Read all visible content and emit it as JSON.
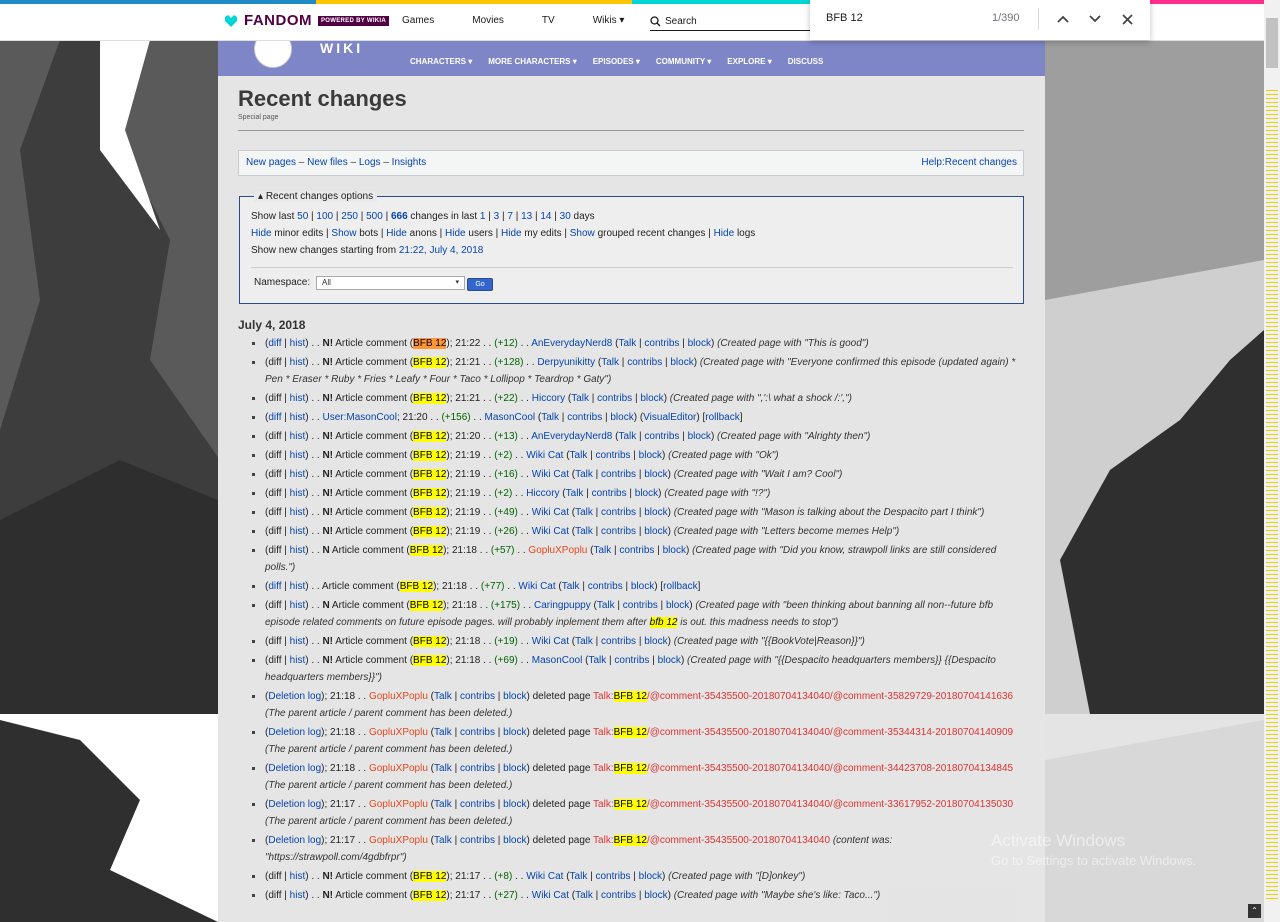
{
  "fandom": {
    "logo_text": "FANDOM",
    "powered_text": "POWERED BY WIKIA",
    "nav": [
      "Games",
      "Movies",
      "TV",
      "Wikis ▾"
    ],
    "search_placeholder": "Search",
    "colors": {
      "brand": "#520044",
      "progress": [
        "#1f8bc7",
        "#ffc500",
        "#00d6d6",
        "#ff2e8c"
      ]
    }
  },
  "find_bar": {
    "query": "BFB 12",
    "count": "1/390",
    "icons": [
      "chevron-up-icon",
      "chevron-down-icon",
      "close-icon"
    ]
  },
  "wiki": {
    "wordmark": "WIKI",
    "nav": [
      "CHARACTERS ▾",
      "MORE CHARACTERS ▾",
      "EPISODES ▾",
      "COMMUNITY ▾",
      "EXPLORE ▾",
      "DISCUSS"
    ],
    "header_color": "#7f86c8"
  },
  "page": {
    "title": "Recent changes",
    "subtitle": "Special page",
    "links": {
      "new_pages": "New pages",
      "new_files": "New files",
      "logs": "Logs",
      "insights": "Insights",
      "help": "Help:Recent changes"
    },
    "options": {
      "legend": "Recent changes options",
      "show_last": "Show last",
      "counts": [
        "50",
        "100",
        "250",
        "500",
        "666"
      ],
      "changes_in_last": "changes in last",
      "days": [
        "1",
        "3",
        "7",
        "13",
        "14",
        "30"
      ],
      "days_word": "days",
      "line2": {
        "hide": "Hide",
        "minor": "minor edits",
        "show": "Show",
        "bots": "bots",
        "hide2": "Hide",
        "anons": "anons",
        "hide3": "Hide",
        "users": "users",
        "hide4": "Hide",
        "my": "my edits",
        "show2": "Show",
        "grouped": "grouped recent changes",
        "hide5": "Hide",
        "logs": "logs"
      },
      "starting_text": "Show new changes starting from",
      "starting_link": "21:22, July 4, 2018",
      "namespace_label": "Namespace:",
      "namespace_value": "All",
      "go": "Go"
    },
    "day": "July 4, 2018"
  },
  "windows": {
    "activate_title": "Activate Windows",
    "activate_sub": "Go to Settings to activate Windows."
  }
}
